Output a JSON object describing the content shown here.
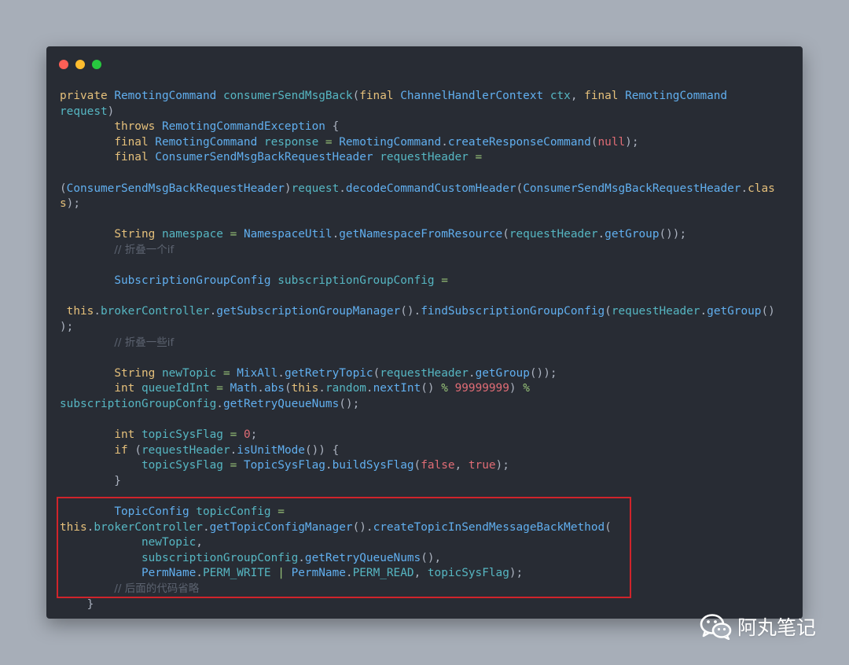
{
  "window": {
    "controls": [
      "close",
      "minimize",
      "maximize"
    ]
  },
  "code": {
    "lines": [
      [
        [
          "kw",
          "private "
        ],
        [
          "ty",
          "RemotingCommand "
        ],
        [
          "var",
          "consumerSendMsgBack"
        ],
        [
          "plain",
          "("
        ],
        [
          "kw",
          "final "
        ],
        [
          "ty",
          "ChannelHandlerContext "
        ],
        [
          "var",
          "ctx"
        ],
        [
          "plain",
          ", "
        ],
        [
          "kw",
          "final "
        ],
        [
          "ty",
          "RemotingCommand"
        ]
      ],
      [
        [
          "var",
          "request"
        ],
        [
          "plain",
          ")"
        ]
      ],
      [
        [
          "plain",
          "        "
        ],
        [
          "kw",
          "throws "
        ],
        [
          "ty",
          "RemotingCommandException "
        ],
        [
          "plain",
          "{"
        ]
      ],
      [
        [
          "plain",
          "        "
        ],
        [
          "kw",
          "final "
        ],
        [
          "ty",
          "RemotingCommand "
        ],
        [
          "var",
          "response "
        ],
        [
          "op",
          "= "
        ],
        [
          "ty",
          "RemotingCommand"
        ],
        [
          "plain",
          "."
        ],
        [
          "fn",
          "createResponseCommand"
        ],
        [
          "plain",
          "("
        ],
        [
          "lit",
          "null"
        ],
        [
          "plain",
          ");"
        ]
      ],
      [
        [
          "plain",
          "        "
        ],
        [
          "kw",
          "final "
        ],
        [
          "ty",
          "ConsumerSendMsgBackRequestHeader "
        ],
        [
          "var",
          "requestHeader "
        ],
        [
          "op",
          "="
        ]
      ],
      [
        [
          "plain",
          ""
        ]
      ],
      [
        [
          "plain",
          "("
        ],
        [
          "ty",
          "ConsumerSendMsgBackRequestHeader"
        ],
        [
          "plain",
          ")"
        ],
        [
          "var",
          "request"
        ],
        [
          "plain",
          "."
        ],
        [
          "fn",
          "decodeCommandCustomHeader"
        ],
        [
          "plain",
          "("
        ],
        [
          "ty",
          "ConsumerSendMsgBackRequestHeader"
        ],
        [
          "plain",
          "."
        ],
        [
          "kw",
          "clas"
        ]
      ],
      [
        [
          "kw",
          "s"
        ],
        [
          "plain",
          ");"
        ]
      ],
      [
        [
          "plain",
          ""
        ]
      ],
      [
        [
          "plain",
          "        "
        ],
        [
          "kw",
          "String "
        ],
        [
          "var",
          "namespace "
        ],
        [
          "op",
          "= "
        ],
        [
          "ty",
          "NamespaceUtil"
        ],
        [
          "plain",
          "."
        ],
        [
          "fn",
          "getNamespaceFromResource"
        ],
        [
          "plain",
          "("
        ],
        [
          "var",
          "requestHeader"
        ],
        [
          "plain",
          "."
        ],
        [
          "fn",
          "getGroup"
        ],
        [
          "plain",
          "());"
        ]
      ],
      [
        [
          "plain",
          "        "
        ],
        [
          "cm",
          "// 折叠一个if"
        ]
      ],
      [
        [
          "plain",
          ""
        ]
      ],
      [
        [
          "plain",
          "        "
        ],
        [
          "ty",
          "SubscriptionGroupConfig "
        ],
        [
          "var",
          "subscriptionGroupConfig "
        ],
        [
          "op",
          "="
        ]
      ],
      [
        [
          "plain",
          ""
        ]
      ],
      [
        [
          "plain",
          " "
        ],
        [
          "kw",
          "this"
        ],
        [
          "plain",
          "."
        ],
        [
          "var",
          "brokerController"
        ],
        [
          "plain",
          "."
        ],
        [
          "fn",
          "getSubscriptionGroupManager"
        ],
        [
          "plain",
          "()."
        ],
        [
          "fn",
          "findSubscriptionGroupConfig"
        ],
        [
          "plain",
          "("
        ],
        [
          "var",
          "requestHeader"
        ],
        [
          "plain",
          "."
        ],
        [
          "fn",
          "getGroup"
        ],
        [
          "plain",
          "()"
        ]
      ],
      [
        [
          "plain",
          ");"
        ]
      ],
      [
        [
          "plain",
          "        "
        ],
        [
          "cm",
          "// 折叠一些if"
        ]
      ],
      [
        [
          "plain",
          ""
        ]
      ],
      [
        [
          "plain",
          "        "
        ],
        [
          "kw",
          "String "
        ],
        [
          "var",
          "newTopic "
        ],
        [
          "op",
          "= "
        ],
        [
          "ty",
          "MixAll"
        ],
        [
          "plain",
          "."
        ],
        [
          "fn",
          "getRetryTopic"
        ],
        [
          "plain",
          "("
        ],
        [
          "var",
          "requestHeader"
        ],
        [
          "plain",
          "."
        ],
        [
          "fn",
          "getGroup"
        ],
        [
          "plain",
          "());"
        ]
      ],
      [
        [
          "plain",
          "        "
        ],
        [
          "kw",
          "int "
        ],
        [
          "var",
          "queueIdInt "
        ],
        [
          "op",
          "= "
        ],
        [
          "ty",
          "Math"
        ],
        [
          "plain",
          "."
        ],
        [
          "fn",
          "abs"
        ],
        [
          "plain",
          "("
        ],
        [
          "kw",
          "this"
        ],
        [
          "plain",
          "."
        ],
        [
          "var",
          "random"
        ],
        [
          "plain",
          "."
        ],
        [
          "fn",
          "nextInt"
        ],
        [
          "plain",
          "() "
        ],
        [
          "op",
          "% "
        ],
        [
          "num",
          "99999999"
        ],
        [
          "plain",
          ") "
        ],
        [
          "op",
          "%"
        ]
      ],
      [
        [
          "var",
          "subscriptionGroupConfig"
        ],
        [
          "plain",
          "."
        ],
        [
          "fn",
          "getRetryQueueNums"
        ],
        [
          "plain",
          "();"
        ]
      ],
      [
        [
          "plain",
          ""
        ]
      ],
      [
        [
          "plain",
          "        "
        ],
        [
          "kw",
          "int "
        ],
        [
          "var",
          "topicSysFlag "
        ],
        [
          "op",
          "= "
        ],
        [
          "num",
          "0"
        ],
        [
          "plain",
          ";"
        ]
      ],
      [
        [
          "plain",
          "        "
        ],
        [
          "kw",
          "if "
        ],
        [
          "plain",
          "("
        ],
        [
          "var",
          "requestHeader"
        ],
        [
          "plain",
          "."
        ],
        [
          "fn",
          "isUnitMode"
        ],
        [
          "plain",
          "()) {"
        ]
      ],
      [
        [
          "plain",
          "            "
        ],
        [
          "var",
          "topicSysFlag "
        ],
        [
          "op",
          "= "
        ],
        [
          "ty",
          "TopicSysFlag"
        ],
        [
          "plain",
          "."
        ],
        [
          "fn",
          "buildSysFlag"
        ],
        [
          "plain",
          "("
        ],
        [
          "lit",
          "false"
        ],
        [
          "plain",
          ", "
        ],
        [
          "lit",
          "true"
        ],
        [
          "plain",
          ");"
        ]
      ],
      [
        [
          "plain",
          "        }"
        ]
      ],
      [
        [
          "plain",
          ""
        ]
      ],
      [
        [
          "plain",
          "        "
        ],
        [
          "ty",
          "TopicConfig "
        ],
        [
          "var",
          "topicConfig "
        ],
        [
          "op",
          "="
        ]
      ],
      [
        [
          "kw",
          "this"
        ],
        [
          "plain",
          "."
        ],
        [
          "var",
          "brokerController"
        ],
        [
          "plain",
          "."
        ],
        [
          "fn",
          "getTopicConfigManager"
        ],
        [
          "plain",
          "()."
        ],
        [
          "fn",
          "createTopicInSendMessageBackMethod"
        ],
        [
          "plain",
          "("
        ]
      ],
      [
        [
          "plain",
          "            "
        ],
        [
          "var",
          "newTopic"
        ],
        [
          "plain",
          ","
        ]
      ],
      [
        [
          "plain",
          "            "
        ],
        [
          "var",
          "subscriptionGroupConfig"
        ],
        [
          "plain",
          "."
        ],
        [
          "fn",
          "getRetryQueueNums"
        ],
        [
          "plain",
          "(),"
        ]
      ],
      [
        [
          "plain",
          "            "
        ],
        [
          "ty",
          "PermName"
        ],
        [
          "plain",
          "."
        ],
        [
          "var",
          "PERM_WRITE "
        ],
        [
          "op",
          "| "
        ],
        [
          "ty",
          "PermName"
        ],
        [
          "plain",
          "."
        ],
        [
          "var",
          "PERM_READ"
        ],
        [
          "plain",
          ", "
        ],
        [
          "var",
          "topicSysFlag"
        ],
        [
          "plain",
          ");"
        ]
      ],
      [
        [
          "plain",
          "        "
        ],
        [
          "cm",
          "// 后面的代码省略"
        ]
      ],
      [
        [
          "plain",
          "    }"
        ]
      ]
    ]
  },
  "watermark": {
    "icon": "wechat-icon",
    "text": "阿丸笔记"
  },
  "colors": {
    "background": "#a7aeb8",
    "editor": "#282c34",
    "keyword": "#e5c07b",
    "type": "#61afef",
    "variable": "#56b6c2",
    "literal": "#e06c75",
    "comment": "#5c6370",
    "highlight_border": "#d0242b"
  }
}
